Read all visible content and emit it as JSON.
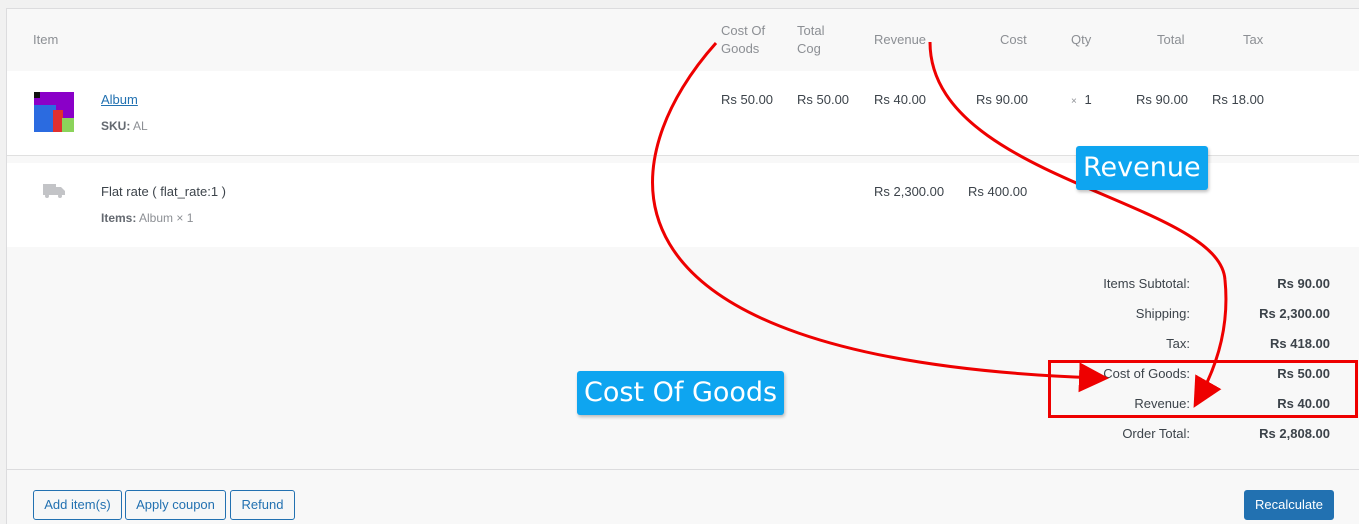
{
  "columns": {
    "item": "Item",
    "cost_of_goods_1": "Cost Of",
    "cost_of_goods_2": "Goods",
    "total_cog_1": "Total",
    "total_cog_2": "Cog",
    "revenue": "Revenue",
    "cost": "Cost",
    "qty": "Qty",
    "total": "Total",
    "tax": "Tax"
  },
  "line_item": {
    "name": "Album",
    "sku_label": "SKU:",
    "sku": "AL",
    "cost_of_goods": "Rs 50.00",
    "total_cog": "Rs 50.00",
    "revenue": "Rs 40.00",
    "cost": "Rs 90.00",
    "qty_times": "×",
    "qty": "1",
    "total": "Rs 90.00",
    "tax": "Rs 18.00",
    "thumbnail_colors": [
      "#8a00c8",
      "#2b6be0",
      "#e03030",
      "#8bd35a",
      "#111111"
    ]
  },
  "shipping_item": {
    "name": "Flat rate ( flat_rate:1 )",
    "items_label": "Items:",
    "items": "Album × 1",
    "revenue": "Rs 2,300.00",
    "cost": "Rs 400.00",
    "icon": "truck-icon"
  },
  "totals": [
    {
      "label": "Items Subtotal:",
      "value": "Rs 90.00"
    },
    {
      "label": "Shipping:",
      "value": "Rs 2,300.00"
    },
    {
      "label": "Tax:",
      "value": "Rs 418.00"
    },
    {
      "label": "Cost of Goods:",
      "value": "Rs 50.00"
    },
    {
      "label": "Revenue:",
      "value": "Rs 40.00"
    },
    {
      "label": "Order Total:",
      "value": "Rs 2,808.00"
    }
  ],
  "buttons": {
    "add_items": "Add item(s)",
    "apply_coupon": "Apply coupon",
    "refund": "Refund",
    "recalculate": "Recalculate"
  },
  "annotations": {
    "revenue_callout": "Revenue",
    "cost_of_goods_callout": "Cost Of Goods"
  },
  "colors": {
    "accent": "#2271b1",
    "annotation_red": "#e00000",
    "callout_blue": "#0ea5f0"
  }
}
